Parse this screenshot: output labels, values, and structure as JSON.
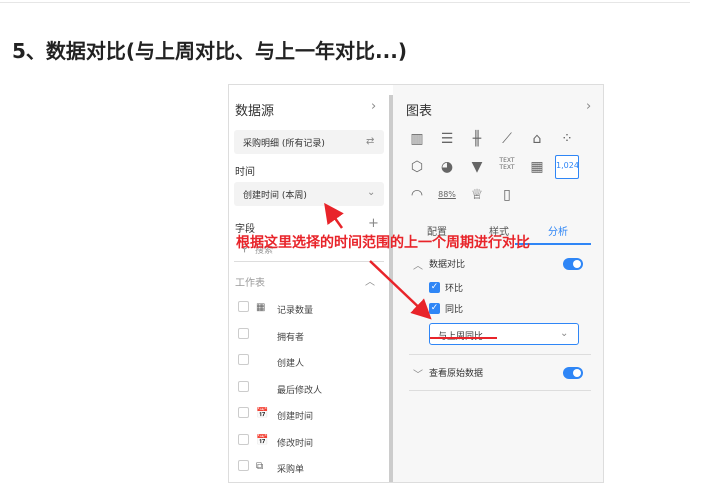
{
  "heading": "5、数据对比(与上周对比、与上一年对比...)",
  "left": {
    "title": "数据源",
    "source": "采购明细 (所有记录)",
    "time_label": "时间",
    "time_value": "创建时间 (本周)",
    "fields_label": "字段",
    "search_placeholder": "搜索",
    "worksheet_label": "工作表",
    "fields": [
      {
        "label": "记录数量",
        "icon": "calculator-icon"
      },
      {
        "label": "拥有者",
        "icon": ""
      },
      {
        "label": "创建人",
        "icon": ""
      },
      {
        "label": "最后修改人",
        "icon": ""
      },
      {
        "label": "创建时间",
        "icon": "calendar-icon"
      },
      {
        "label": "修改时间",
        "icon": "calendar-icon"
      },
      {
        "label": "采购单",
        "icon": "relation-icon"
      }
    ]
  },
  "right": {
    "title": "图表",
    "selected_chart_label": "1,024",
    "percent_label": "88%",
    "tabs": [
      "配置",
      "样式",
      "分析"
    ],
    "active_tab": "分析",
    "compare_title": "数据对比",
    "compare_enabled": true,
    "mom_label": "环比",
    "mom_checked": true,
    "yoy_label": "同比",
    "yoy_checked": true,
    "compare_select": "与上周同比",
    "raw_data_label": "查看原始数据",
    "raw_data_enabled": true
  },
  "annotation": "根据这里选择的时间范围的上一个周期进行对比",
  "colors": {
    "accent": "#2f86f6",
    "annotation": "#e8242a"
  }
}
